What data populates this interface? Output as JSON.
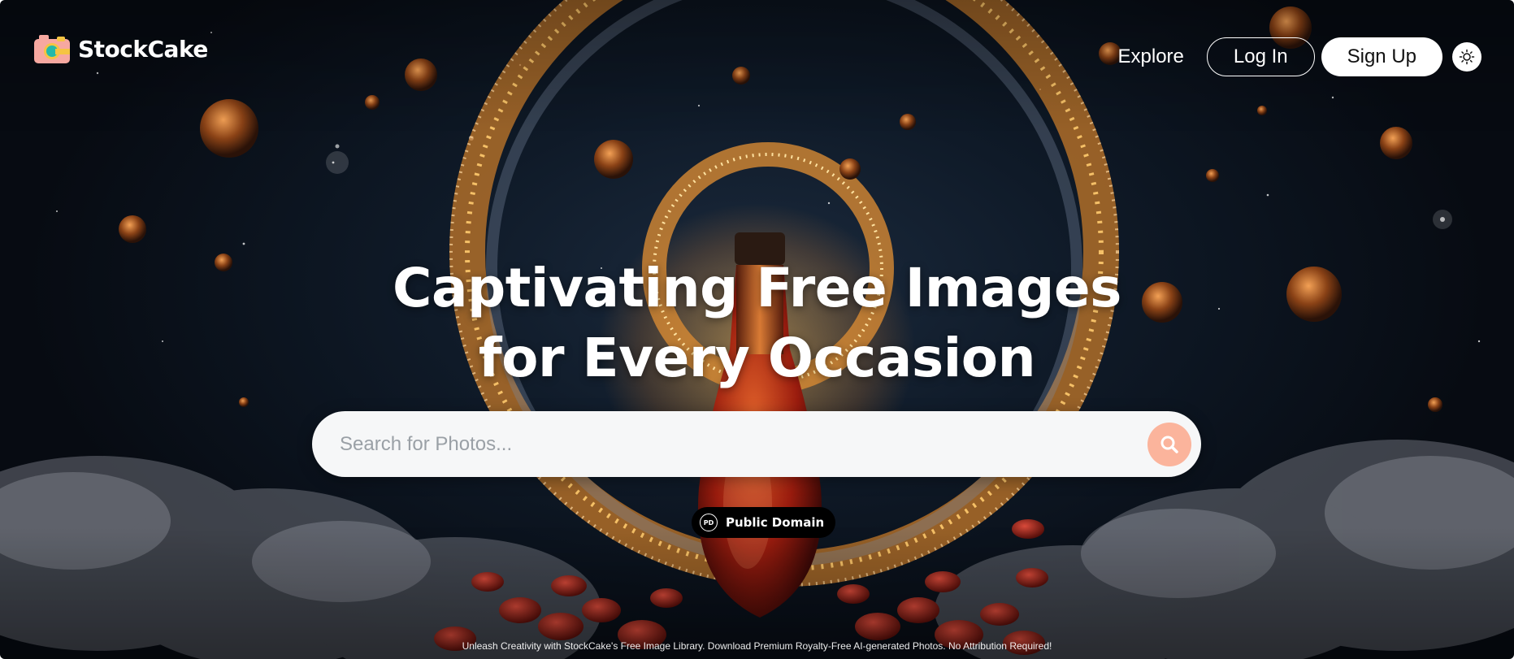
{
  "brand": {
    "name": "StockCake",
    "logo_icon": "camera-icon",
    "colors": {
      "pink": "#f7a8a0",
      "yellow": "#f5c443",
      "teal": "#23b9a9"
    }
  },
  "nav": {
    "explore_label": "Explore",
    "login_label": "Log In",
    "signup_label": "Sign Up",
    "theme_icon": "sun-icon"
  },
  "hero": {
    "headline_line1": "Captivating Free Images",
    "headline_line2": "for Every Occasion"
  },
  "search": {
    "placeholder": "Search for Photos...",
    "value": "",
    "button_icon": "search-icon",
    "button_color": "#fbb49c"
  },
  "license_pill": {
    "badge": "PD",
    "label": "Public Domain"
  },
  "footer": {
    "tagline": "Unleash Creativity with StockCake's Free Image Library. Download Premium Royalty-Free AI-generated Photos. No Attribution Required!"
  }
}
